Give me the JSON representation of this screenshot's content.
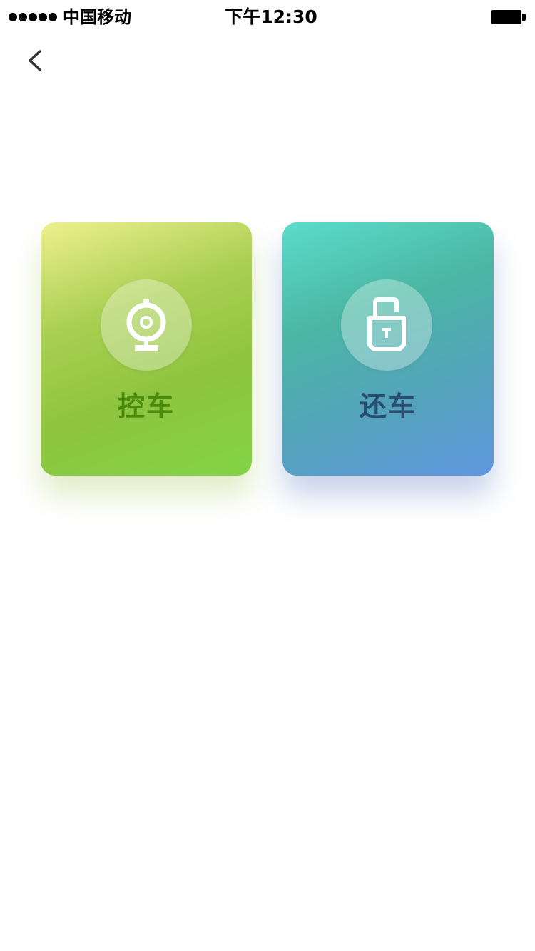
{
  "status_bar": {
    "carrier": "中国移动",
    "time": "下午12:30",
    "signal_icon": "signal-dots-icon",
    "battery_icon": "battery-icon"
  },
  "nav": {
    "back_icon": "chevron-left-icon"
  },
  "actions": [
    {
      "label": "控车",
      "icon": "webcam-icon",
      "colors": {
        "gradient_start": "#eef08e",
        "gradient_end": "#82d447",
        "label": "#4a8a0c"
      }
    },
    {
      "label": "还车",
      "icon": "unlock-icon",
      "colors": {
        "gradient_start": "#5bdccb",
        "gradient_end": "#5f96df",
        "label": "#2a4d72"
      }
    }
  ]
}
